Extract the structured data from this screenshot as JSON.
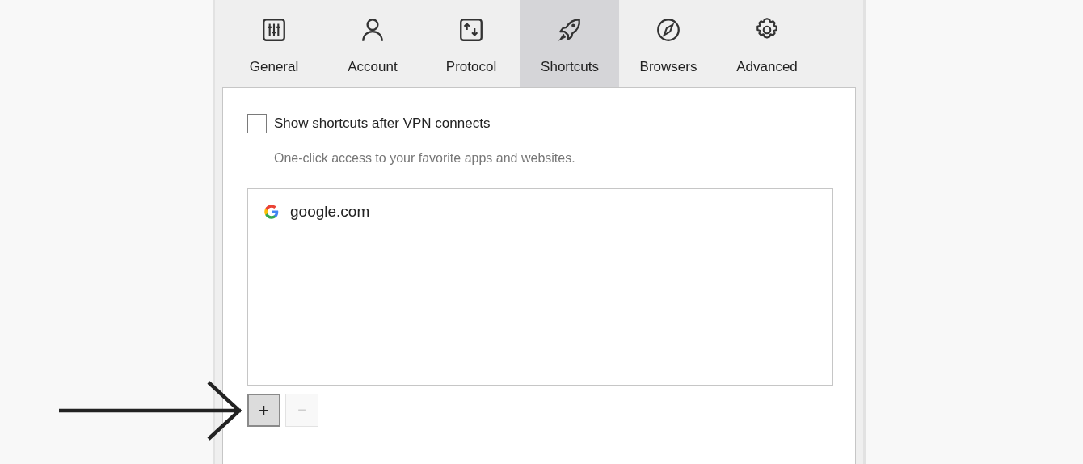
{
  "tabs": [
    {
      "label": "General",
      "selected": false
    },
    {
      "label": "Account",
      "selected": false
    },
    {
      "label": "Protocol",
      "selected": false
    },
    {
      "label": "Shortcuts",
      "selected": true
    },
    {
      "label": "Browsers",
      "selected": false
    },
    {
      "label": "Advanced",
      "selected": false
    }
  ],
  "show_shortcuts": {
    "label": "Show shortcuts after VPN connects",
    "checked": false
  },
  "description": "One-click access to your favorite apps and websites.",
  "shortcuts": [
    {
      "label": "google.com",
      "selected": false
    }
  ],
  "buttons": [
    {
      "label": "+",
      "disabled": false
    },
    {
      "label": "−",
      "disabled": true
    }
  ]
}
